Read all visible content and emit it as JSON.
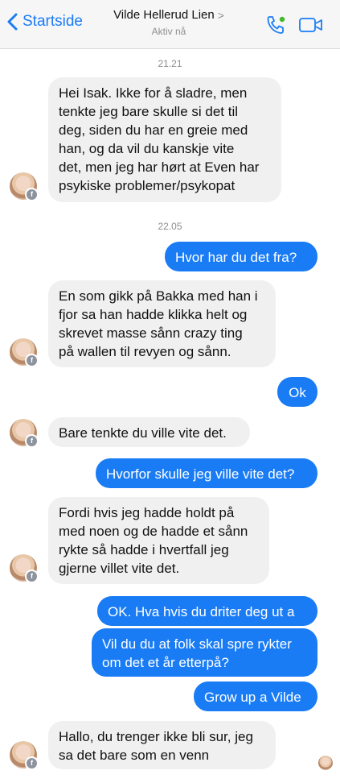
{
  "header": {
    "back_label": "Startside",
    "contact_name": "Vilde Hellerud Lien",
    "status": "Aktiv nå"
  },
  "timestamps": [
    "21.21",
    "22.05"
  ],
  "messages": [
    {
      "from": "contact",
      "lines": [
        "Hei Isak. Ikke for å sladre, men",
        "tenkte jeg bare skulle si det til",
        "deg, siden du har en greie med",
        "han, og da vil du kanskje vite",
        "det, men jeg har hørt at Even har",
        "psykiske problemer/psykopat"
      ]
    },
    {
      "from": "me",
      "lines": [
        "Hvor har du det fra?"
      ]
    },
    {
      "from": "contact",
      "lines": [
        "En som gikk på Bakka med han i",
        "fjor sa han hadde klikka helt og",
        "skrevet masse sånn crazy ting",
        "på wallen til revyen og sånn."
      ]
    },
    {
      "from": "me",
      "lines": [
        "Ok"
      ]
    },
    {
      "from": "contact",
      "lines": [
        "Bare tenkte du ville vite det."
      ]
    },
    {
      "from": "me",
      "lines": [
        "Hvorfor skulle jeg ville vite det?"
      ]
    },
    {
      "from": "contact",
      "lines": [
        "Fordi hvis jeg hadde holdt på",
        "med noen og de hadde et sånn",
        "rykte så hadde i hvertfall jeg",
        "gjerne villet vite det."
      ]
    },
    {
      "from": "me",
      "lines": [
        "OK. Hva hvis du driter deg ut a"
      ]
    },
    {
      "from": "me",
      "lines": [
        "Vil du du at folk skal spre rykter",
        "om det et år etterpå?"
      ]
    },
    {
      "from": "me",
      "lines": [
        "Grow up a Vilde"
      ]
    },
    {
      "from": "contact",
      "lines": [
        "Hallo, du trenger ikke bli sur, jeg",
        "sa det bare som en venn"
      ]
    }
  ],
  "colors": {
    "accent": "#1a7cf5",
    "incoming_bubble": "#f1f0f0",
    "muted": "#8e8e93"
  },
  "icons": [
    "chevron-left-icon",
    "phone-icon",
    "video-camera-icon",
    "facebook-badge-icon"
  ]
}
